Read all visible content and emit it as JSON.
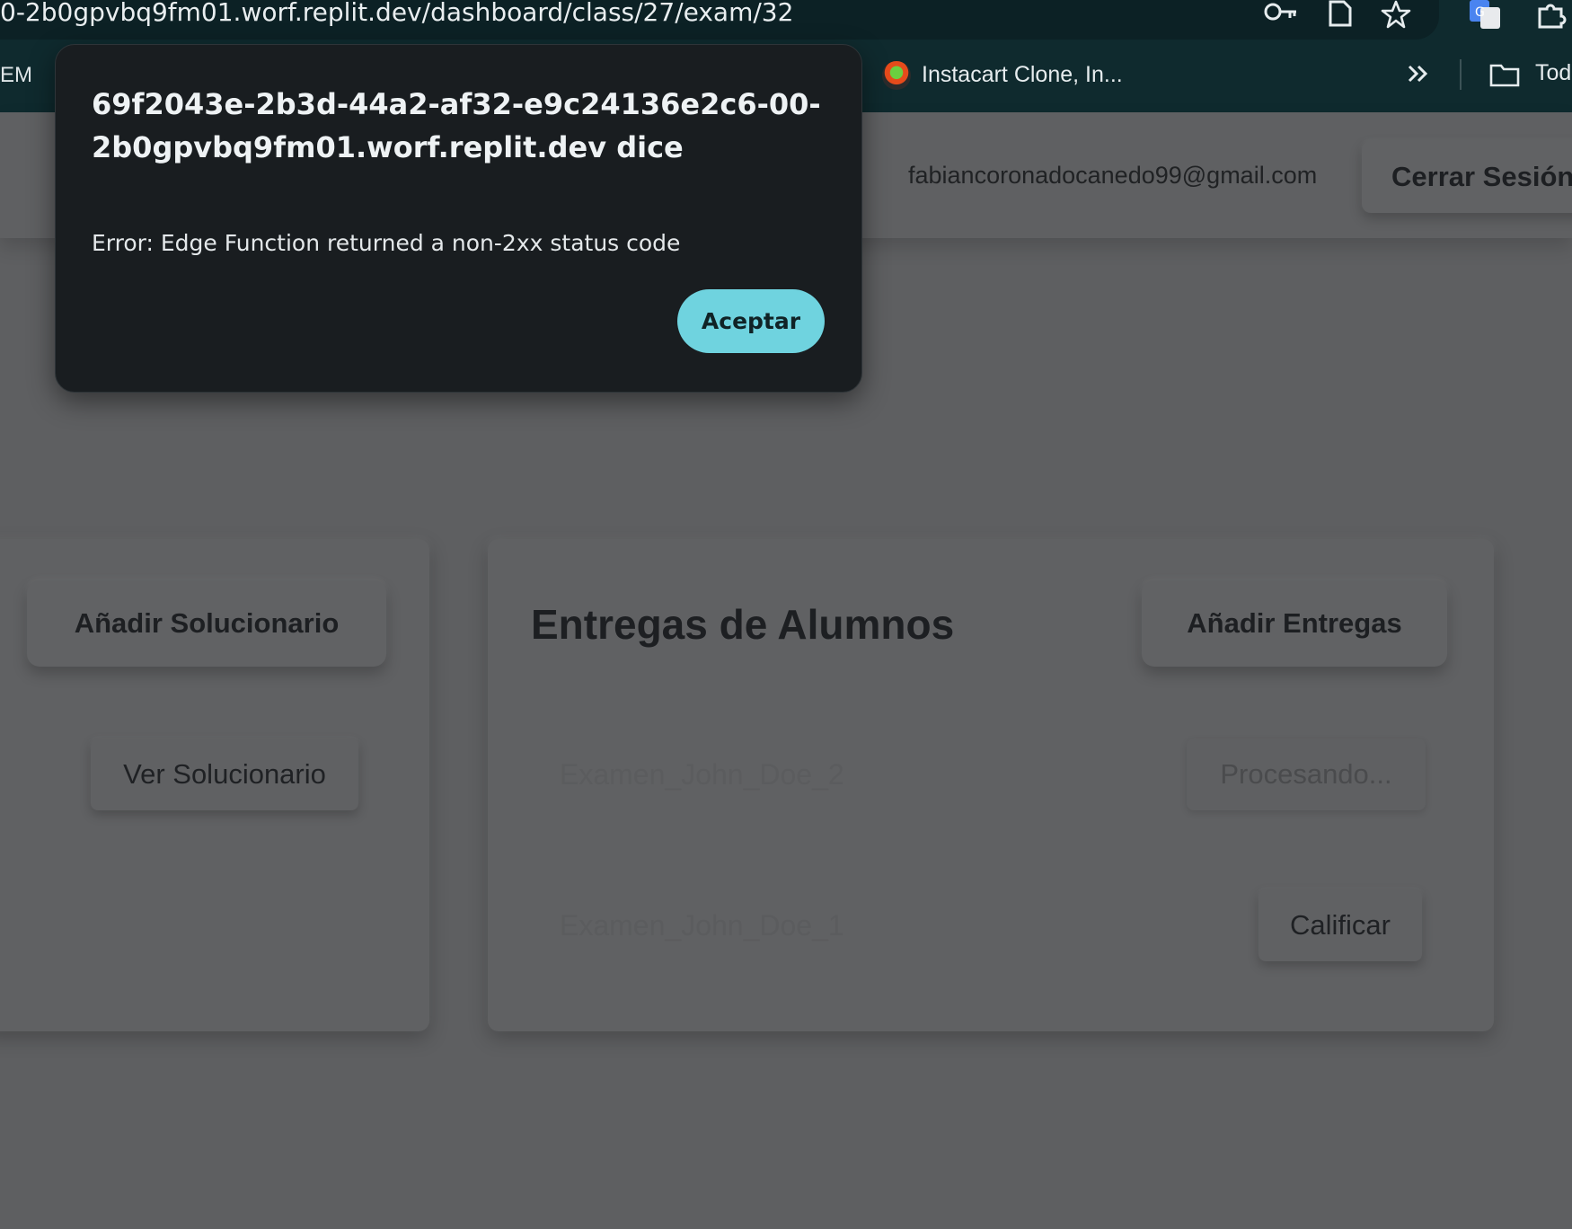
{
  "browser": {
    "url": "0-2b0gpvbq9fm01.worf.replit.dev/dashboard/class/27/exam/32",
    "bookmarks": {
      "partial_left": "EM",
      "item_label": "Instacart Clone, In...",
      "folder_label": "Tod"
    }
  },
  "header": {
    "user_email": "fabiancoronadocanedo99@gmail.com",
    "logout_label": "Cerrar Sesión"
  },
  "solutions_card": {
    "add_button": "Añadir Solucionario",
    "view_button": "Ver Solucionario"
  },
  "submissions_card": {
    "title": "Entregas de Alumnos",
    "add_button": "Añadir Entregas",
    "rows": [
      {
        "name": "Examen_John_Doe_2",
        "action": "Procesando..."
      },
      {
        "name": "Examen_John_Doe_1",
        "action": "Calificar"
      }
    ]
  },
  "dialog": {
    "origin": "69f2043e-2b3d-44a2-af32-e9c24136e2c6-00-2b0gpvbq9fm01.worf.replit.dev dice",
    "message": "Error: Edge Function returned a non-2xx status code",
    "ok_label": "Aceptar",
    "accent_color": "#6fd3df"
  }
}
